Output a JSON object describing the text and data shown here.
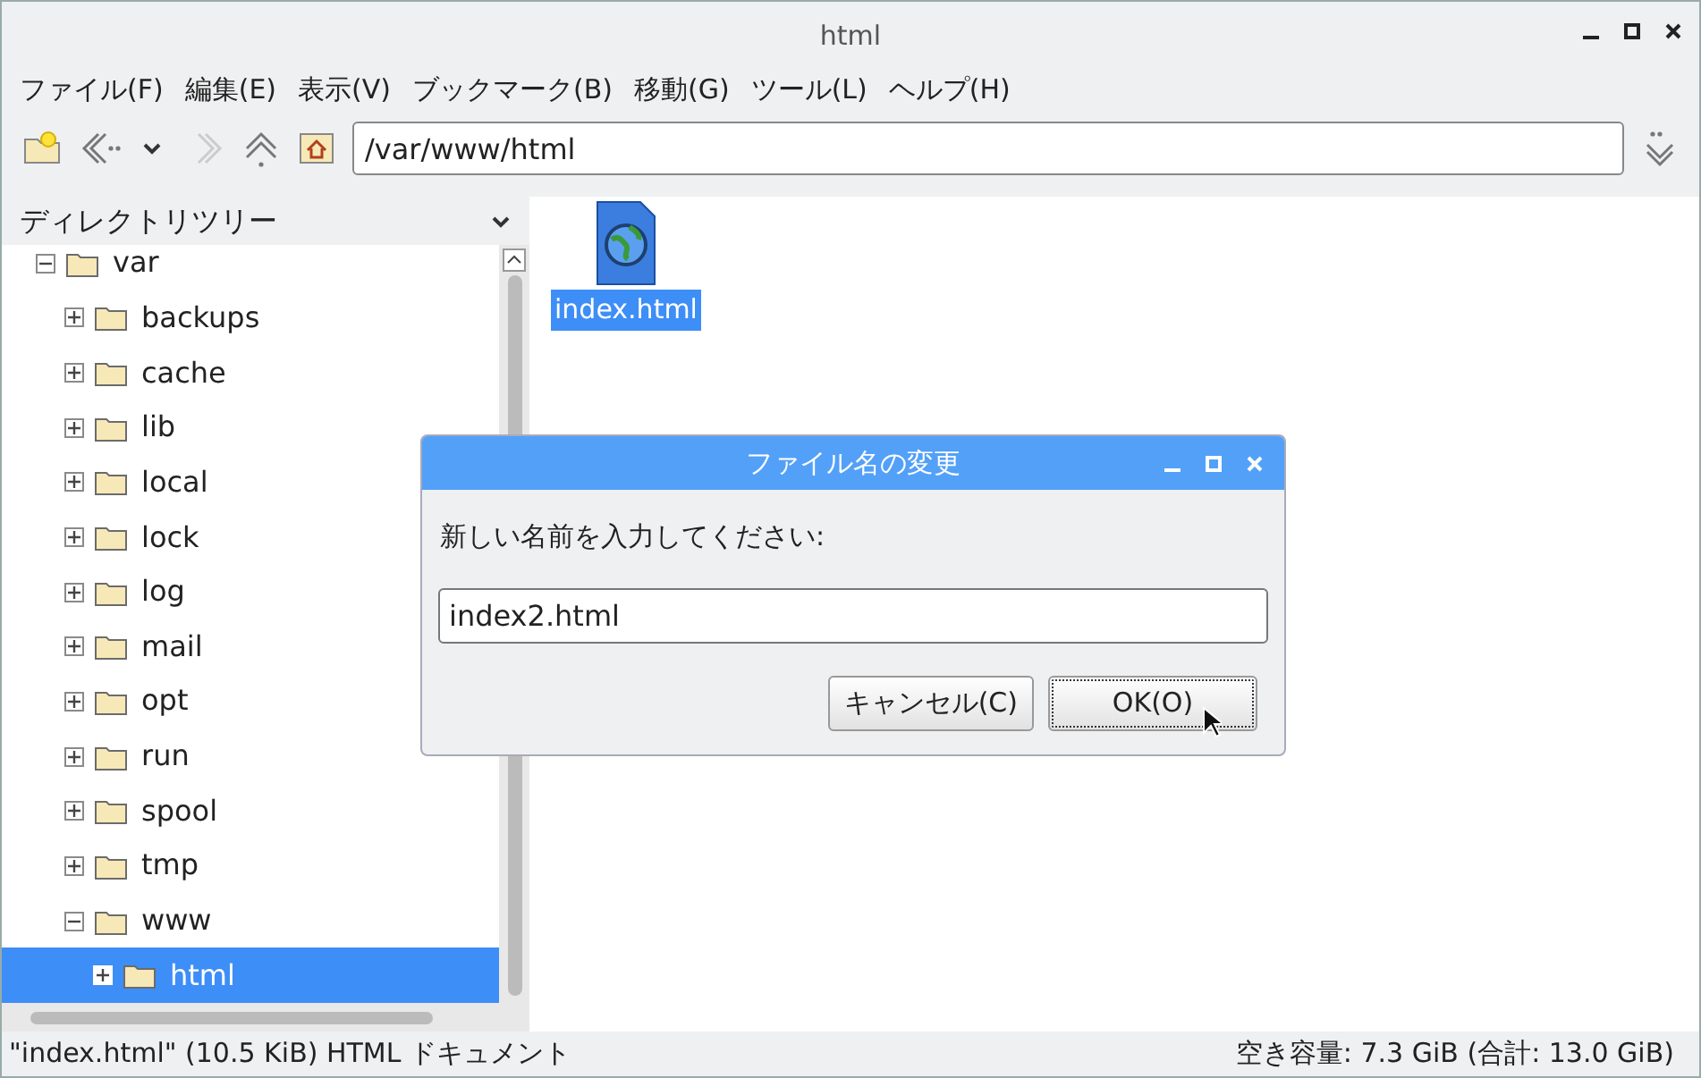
{
  "window": {
    "title": "html"
  },
  "menu": [
    "ファイル(F)",
    "編集(E)",
    "表示(V)",
    "ブックマーク(B)",
    "移動(G)",
    "ツール(L)",
    "ヘルプ(H)"
  ],
  "location": {
    "value": "/var/www/html"
  },
  "sidebar": {
    "title": "ディレクトリツリー",
    "tree": [
      {
        "label": "var",
        "expanded": true,
        "selected": false,
        "children": [
          {
            "label": "backups",
            "expanded": false,
            "selected": false
          },
          {
            "label": "cache",
            "expanded": false,
            "selected": false
          },
          {
            "label": "lib",
            "expanded": false,
            "selected": false
          },
          {
            "label": "local",
            "expanded": false,
            "selected": false
          },
          {
            "label": "lock",
            "expanded": false,
            "selected": false
          },
          {
            "label": "log",
            "expanded": false,
            "selected": false
          },
          {
            "label": "mail",
            "expanded": false,
            "selected": false
          },
          {
            "label": "opt",
            "expanded": false,
            "selected": false
          },
          {
            "label": "run",
            "expanded": false,
            "selected": false
          },
          {
            "label": "spool",
            "expanded": false,
            "selected": false
          },
          {
            "label": "tmp",
            "expanded": false,
            "selected": false
          },
          {
            "label": "www",
            "expanded": true,
            "selected": false,
            "children": [
              {
                "label": "html",
                "expanded": false,
                "selected": true
              }
            ]
          }
        ]
      }
    ]
  },
  "files": [
    {
      "name": "index.html",
      "selected": true
    }
  ],
  "dialog": {
    "title": "ファイル名の変更",
    "prompt": "新しい名前を入力してください:",
    "value": "index2.html",
    "buttons": [
      {
        "label": "キャンセル(C)",
        "focused": false
      },
      {
        "label": "OK(O)",
        "focused": true
      }
    ]
  },
  "status_bar": {
    "left": "\"index.html\" (10.5 KiB) HTML ドキュメント",
    "right": "空き容量: 7.3 GiB (合計: 13.0 GiB)"
  }
}
